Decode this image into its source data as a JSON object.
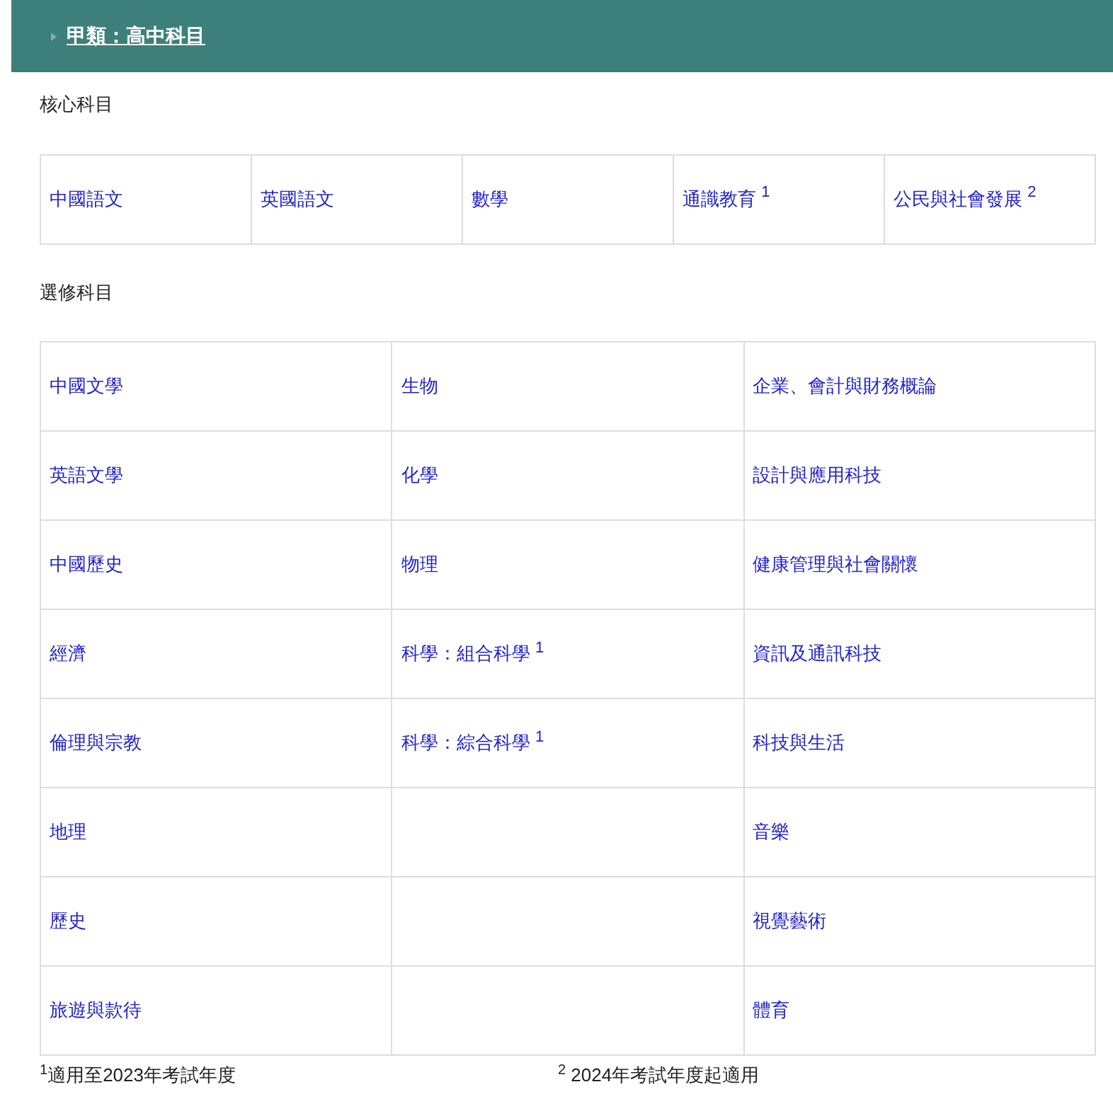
{
  "header": {
    "title": "甲類：高中科目"
  },
  "core": {
    "heading": "核心科目",
    "subjects": [
      "中國語文",
      "英國語文",
      "數學",
      "通識教育 $^{1}$",
      "公民與社會發展 $^{2}$"
    ]
  },
  "elective": {
    "heading": "選修科目",
    "columns": [
      [
        "中國文學",
        "英語文學",
        "中國歷史",
        "經濟",
        "倫理與宗教",
        "地理",
        "歷史",
        "旅遊與款待"
      ],
      [
        "生物",
        "化學",
        "物理",
        "科學：組合科學 $^{1}$",
        "科學：綜合科學 $^{1}$"
      ],
      [
        "企業、會計與財務概論",
        "設計與應用科技",
        "健康管理與社會關懷",
        "資訊及通訊科技",
        "科技與生活",
        "音樂",
        "視覺藝術",
        "體育"
      ]
    ]
  },
  "footnotes": [
    "$^{1}$適用至2023年考試年度",
    "$^{2}$ 2024年考試年度起適用"
  ]
}
